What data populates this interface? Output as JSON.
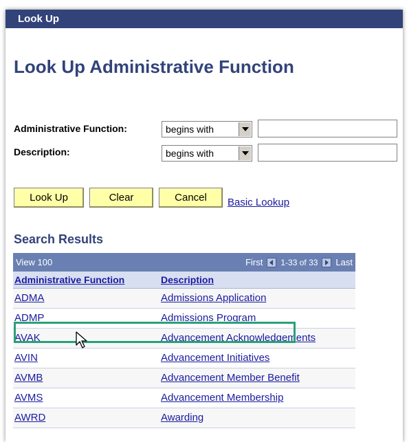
{
  "window": {
    "title": "Look Up"
  },
  "page": {
    "title": "Look Up Administrative Function"
  },
  "criteria": [
    {
      "label": "Administrative Function:",
      "operator": "begins with",
      "value": ""
    },
    {
      "label": "Description:",
      "operator": "begins with",
      "value": ""
    }
  ],
  "buttons": {
    "lookup": "Look Up",
    "clear": "Clear",
    "cancel": "Cancel",
    "basic_lookup": "Basic Lookup"
  },
  "results": {
    "title": "Search Results",
    "view_all": "View 100",
    "first": "First",
    "range": "1-33 of 33",
    "last": "Last",
    "columns": [
      "Administrative Function",
      "Description"
    ],
    "rows": [
      {
        "code": "ADMA",
        "desc": "Admissions Application"
      },
      {
        "code": "ADMP",
        "desc": "Admissions Program"
      },
      {
        "code": "AVAK",
        "desc": "Advancement Acknowledgements"
      },
      {
        "code": "AVIN",
        "desc": "Advancement Initiatives"
      },
      {
        "code": "AVMB",
        "desc": "Advancement Member Benefit"
      },
      {
        "code": "AVMS",
        "desc": "Advancement Membership"
      },
      {
        "code": "AWRD",
        "desc": "Awarding"
      }
    ]
  },
  "colors": {
    "title_bar": "#32437a",
    "nav_bar": "#6a80b3",
    "button_bg": "#ffffa8",
    "link": "#1a1aa0",
    "highlight": "#2aa079"
  }
}
